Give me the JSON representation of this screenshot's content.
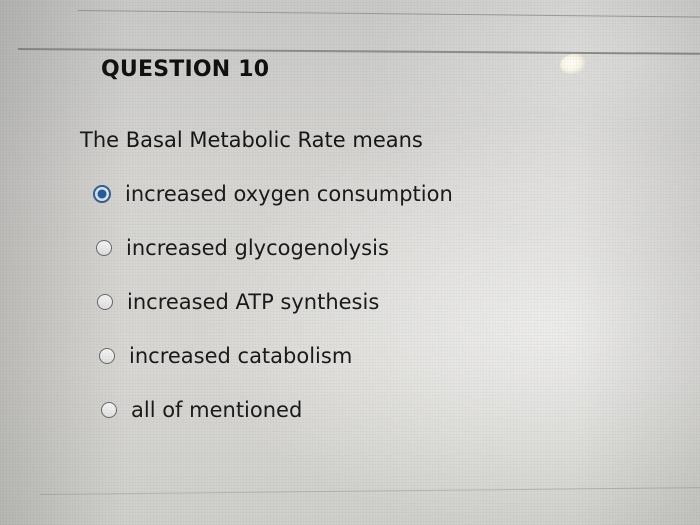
{
  "question": {
    "title": "QUESTION 10",
    "text": "The Basal Metabolic Rate means",
    "options": [
      {
        "label": "increased oxygen consumption",
        "selected": true
      },
      {
        "label": "increased glycogenolysis",
        "selected": false
      },
      {
        "label": "increased ATP synthesis",
        "selected": false
      },
      {
        "label": "increased catabolism",
        "selected": false
      },
      {
        "label": "all of mentioned",
        "selected": false
      }
    ]
  },
  "colors": {
    "selected_radio": "#1f5d9e",
    "background": "#d6d5d2",
    "text": "#1a1a1a"
  }
}
